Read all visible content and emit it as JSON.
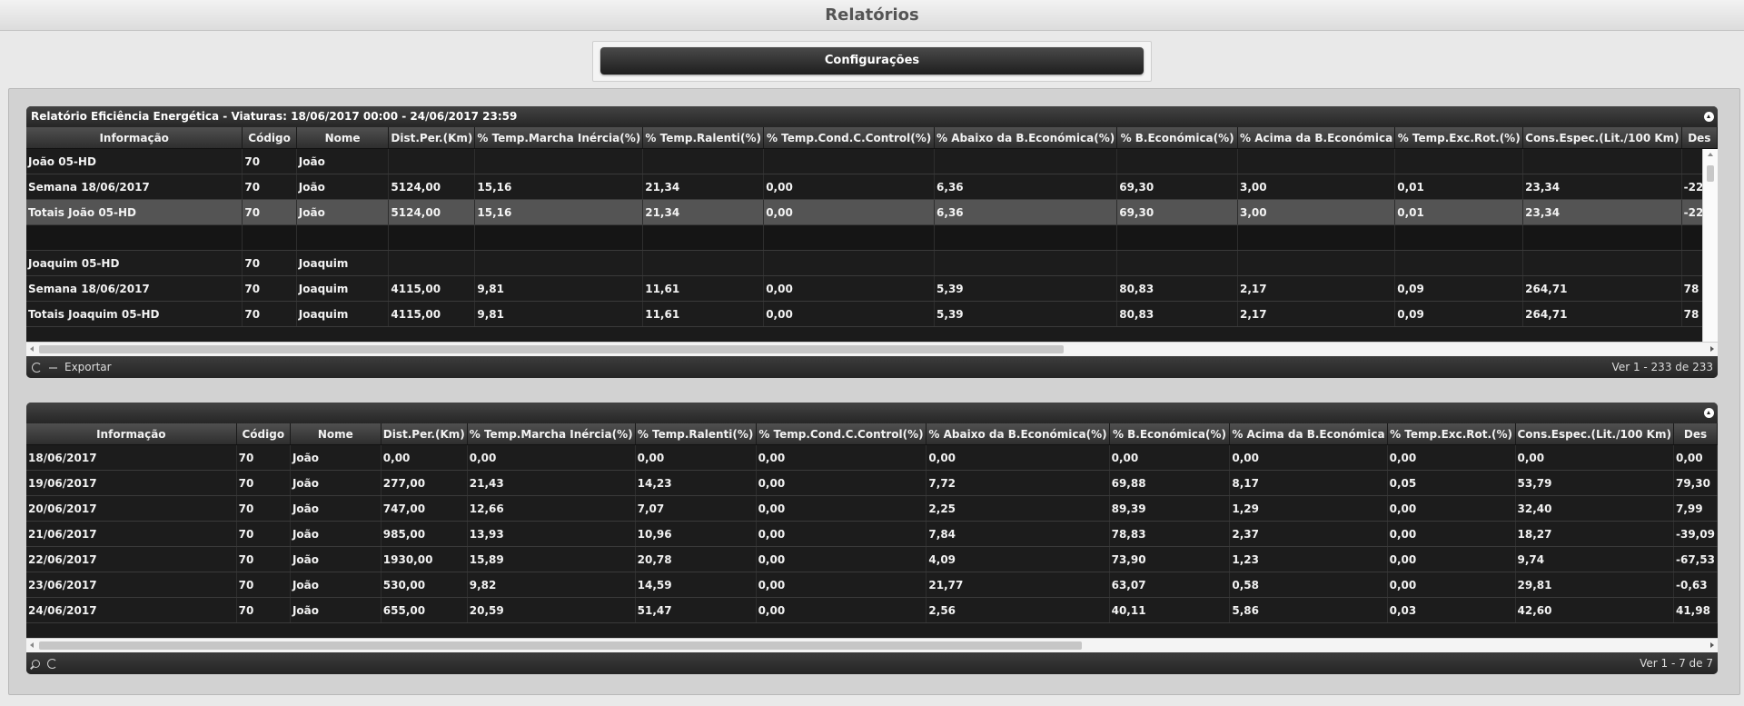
{
  "page_title": "Relatórios",
  "config_button": "Configurações",
  "columns": [
    "Informação",
    "Código",
    "Nome",
    "Dist.Per.(Km)",
    "% Temp.Marcha Inércia(%)",
    "% Temp.Ralenti(%)",
    "% Temp.Cond.C.Control(%)",
    "% Abaixo da B.Económica(%)",
    "% B.Económica(%)",
    "% Acima da B.Económica",
    "% Temp.Exc.Rot.(%)",
    "Cons.Espec.(Lit./100 Km)",
    "Des"
  ],
  "grid1": {
    "caption": "Relatório Eficiência Energética - Viaturas: 18/06/2017 00:00 - 24/06/2017 23:59",
    "rows": [
      [
        "João 05-HD",
        "70",
        "João",
        "",
        "",
        "",
        "",
        "",
        "",
        "",
        "",
        "",
        ""
      ],
      [
        "Semana 18/06/2017",
        "70",
        "João",
        "5124,00",
        "15,16",
        "21,34",
        "0,00",
        "6,36",
        "69,30",
        "3,00",
        "0,01",
        "23,34",
        "-22"
      ],
      [
        "Totais João 05-HD",
        "70",
        "João",
        "5124,00",
        "15,16",
        "21,34",
        "0,00",
        "6,36",
        "69,30",
        "3,00",
        "0,01",
        "23,34",
        "-22"
      ],
      [
        "",
        "",
        "",
        "",
        "",
        "",
        "",
        "",
        "",
        "",
        "",
        "",
        ""
      ],
      [
        "Joaquim 05-HD",
        "70",
        "Joaquim",
        "",
        "",
        "",
        "",
        "",
        "",
        "",
        "",
        "",
        ""
      ],
      [
        "Semana 18/06/2017",
        "70",
        "Joaquim",
        "4115,00",
        "9,81",
        "11,61",
        "0,00",
        "5,39",
        "80,83",
        "2,17",
        "0,09",
        "264,71",
        "78"
      ],
      [
        "Totais Joaquim 05-HD",
        "70",
        "Joaquim",
        "4115,00",
        "9,81",
        "11,61",
        "0,00",
        "5,39",
        "80,83",
        "2,17",
        "0,09",
        "264,71",
        "78"
      ]
    ],
    "export_label": "Exportar",
    "pager_text": "Ver 1 - 233 de 233"
  },
  "grid2": {
    "rows": [
      [
        "18/06/2017",
        "70",
        "João",
        "0,00",
        "0,00",
        "0,00",
        "0,00",
        "0,00",
        "0,00",
        "0,00",
        "0,00",
        "0,00",
        "0,00"
      ],
      [
        "19/06/2017",
        "70",
        "João",
        "277,00",
        "21,43",
        "14,23",
        "0,00",
        "7,72",
        "69,88",
        "8,17",
        "0,05",
        "53,79",
        "79,30"
      ],
      [
        "20/06/2017",
        "70",
        "João",
        "747,00",
        "12,66",
        "7,07",
        "0,00",
        "2,25",
        "89,39",
        "1,29",
        "0,00",
        "32,40",
        "7,99"
      ],
      [
        "21/06/2017",
        "70",
        "João",
        "985,00",
        "13,93",
        "10,96",
        "0,00",
        "7,84",
        "78,83",
        "2,37",
        "0,00",
        "18,27",
        "-39,09"
      ],
      [
        "22/06/2017",
        "70",
        "João",
        "1930,00",
        "15,89",
        "20,78",
        "0,00",
        "4,09",
        "73,90",
        "1,23",
        "0,00",
        "9,74",
        "-67,53"
      ],
      [
        "23/06/2017",
        "70",
        "João",
        "530,00",
        "9,82",
        "14,59",
        "0,00",
        "21,77",
        "63,07",
        "0,58",
        "0,00",
        "29,81",
        "-0,63"
      ],
      [
        "24/06/2017",
        "70",
        "João",
        "655,00",
        "20,59",
        "51,47",
        "0,00",
        "2,56",
        "40,11",
        "5,86",
        "0,03",
        "42,60",
        "41,98"
      ]
    ],
    "pager_text": "Ver 1 - 7 de 7"
  },
  "icons": [
    "refresh-icon",
    "separator-icon",
    "search-icon",
    "collapse-icon"
  ]
}
